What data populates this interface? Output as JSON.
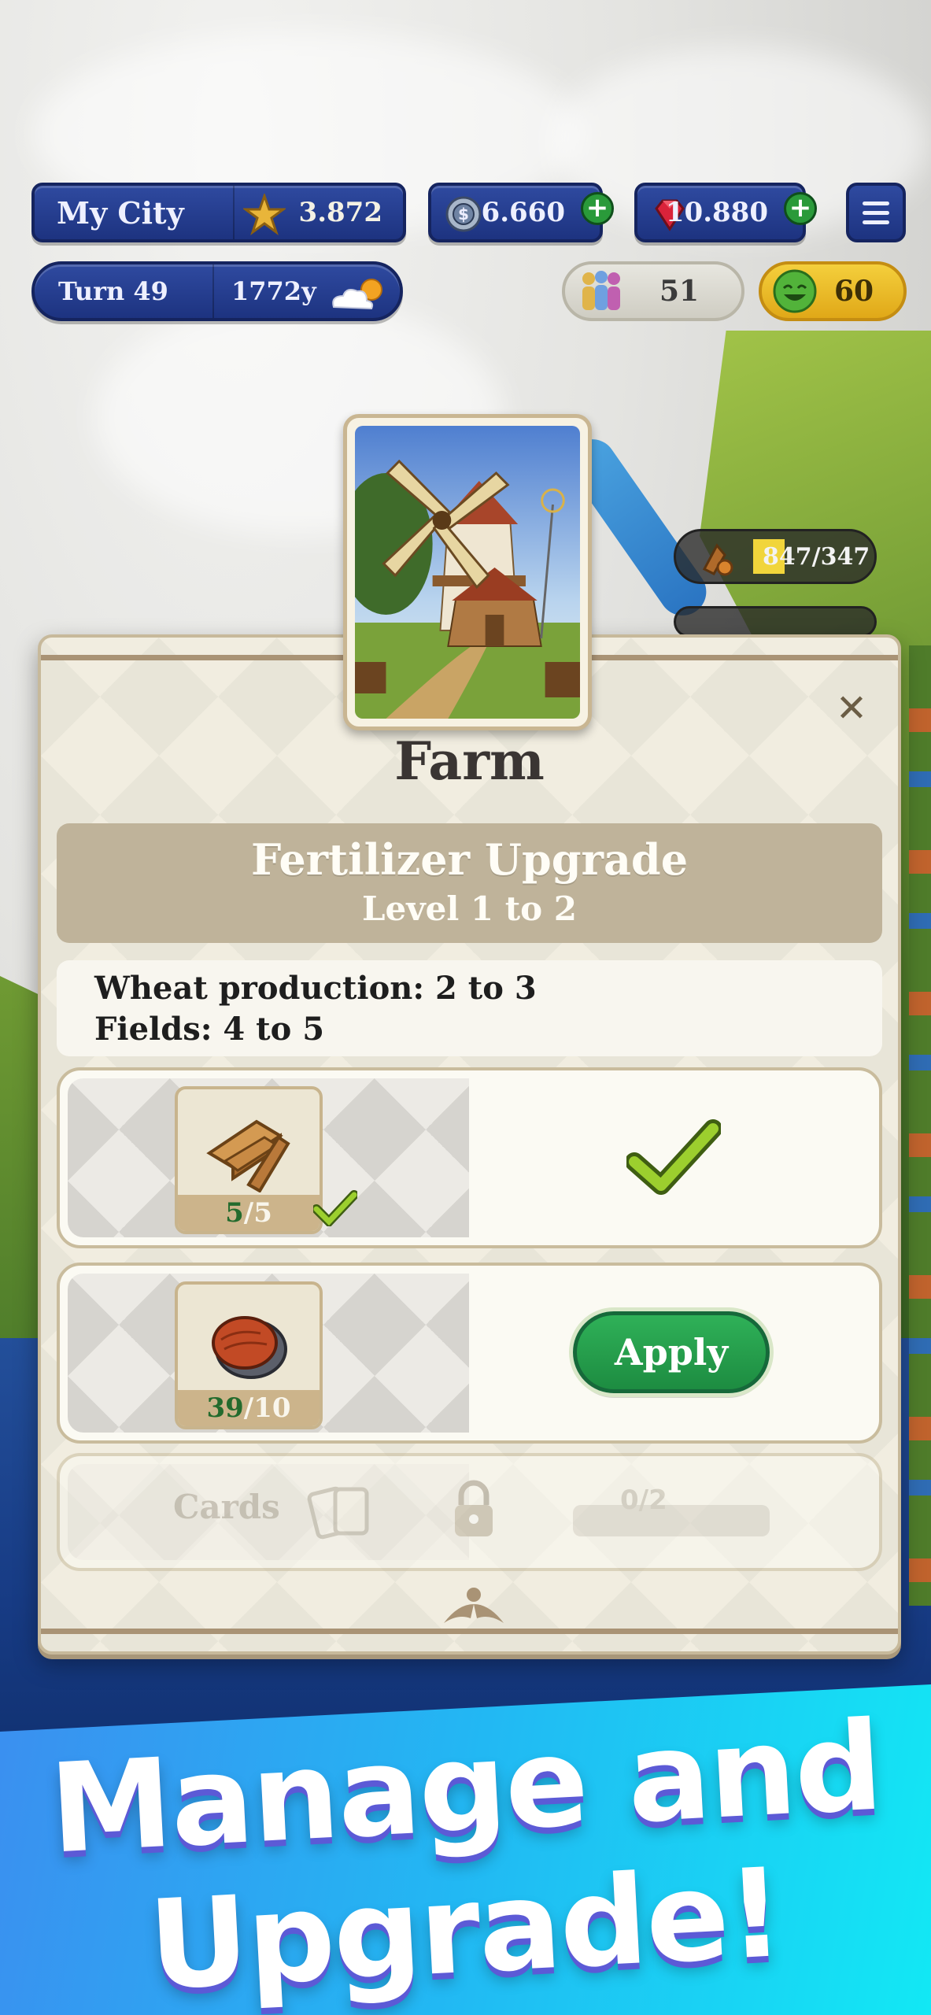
{
  "hud": {
    "city_name": "My City",
    "city_score": "3.872",
    "coins": "6.660",
    "gems": "10.880",
    "turn": "Turn 49",
    "year": "1772y",
    "population": "51",
    "happiness": "60",
    "resource_counter": "847/347",
    "icons": {
      "score": "star-icon",
      "coins": "coin-icon",
      "gems": "ruby-icon",
      "weather": "cloud-sun-icon",
      "population": "people-icon",
      "happiness": "smiley-icon",
      "menu": "hamburger-icon"
    }
  },
  "modal": {
    "building_name": "Farm",
    "upgrade_title": "Fertilizer Upgrade",
    "upgrade_level": "Level 1 to 2",
    "effects": [
      "Wheat production: 2 to 3",
      "Fields: 4 to 5"
    ],
    "requirements": [
      {
        "icon": "wood-planks-icon",
        "have": "5",
        "need": "/5",
        "status": "complete"
      },
      {
        "icon": "leather-icon",
        "have": "39",
        "need": "/10",
        "status": "ready",
        "action_label": "Apply"
      },
      {
        "label": "Cards",
        "icon": "cards-icon",
        "status": "locked",
        "progress_text": "0/2"
      }
    ],
    "close_icon": "close-icon"
  },
  "promo": {
    "line1": "Manage and",
    "line2": "Upgrade!"
  },
  "colors": {
    "hud_blue": "#1d3380",
    "apply_green": "#1d8c41",
    "modal_bg": "#f1ede0",
    "banner_tan": "#bfb39a",
    "promo_cyan": "#12e8f4"
  }
}
